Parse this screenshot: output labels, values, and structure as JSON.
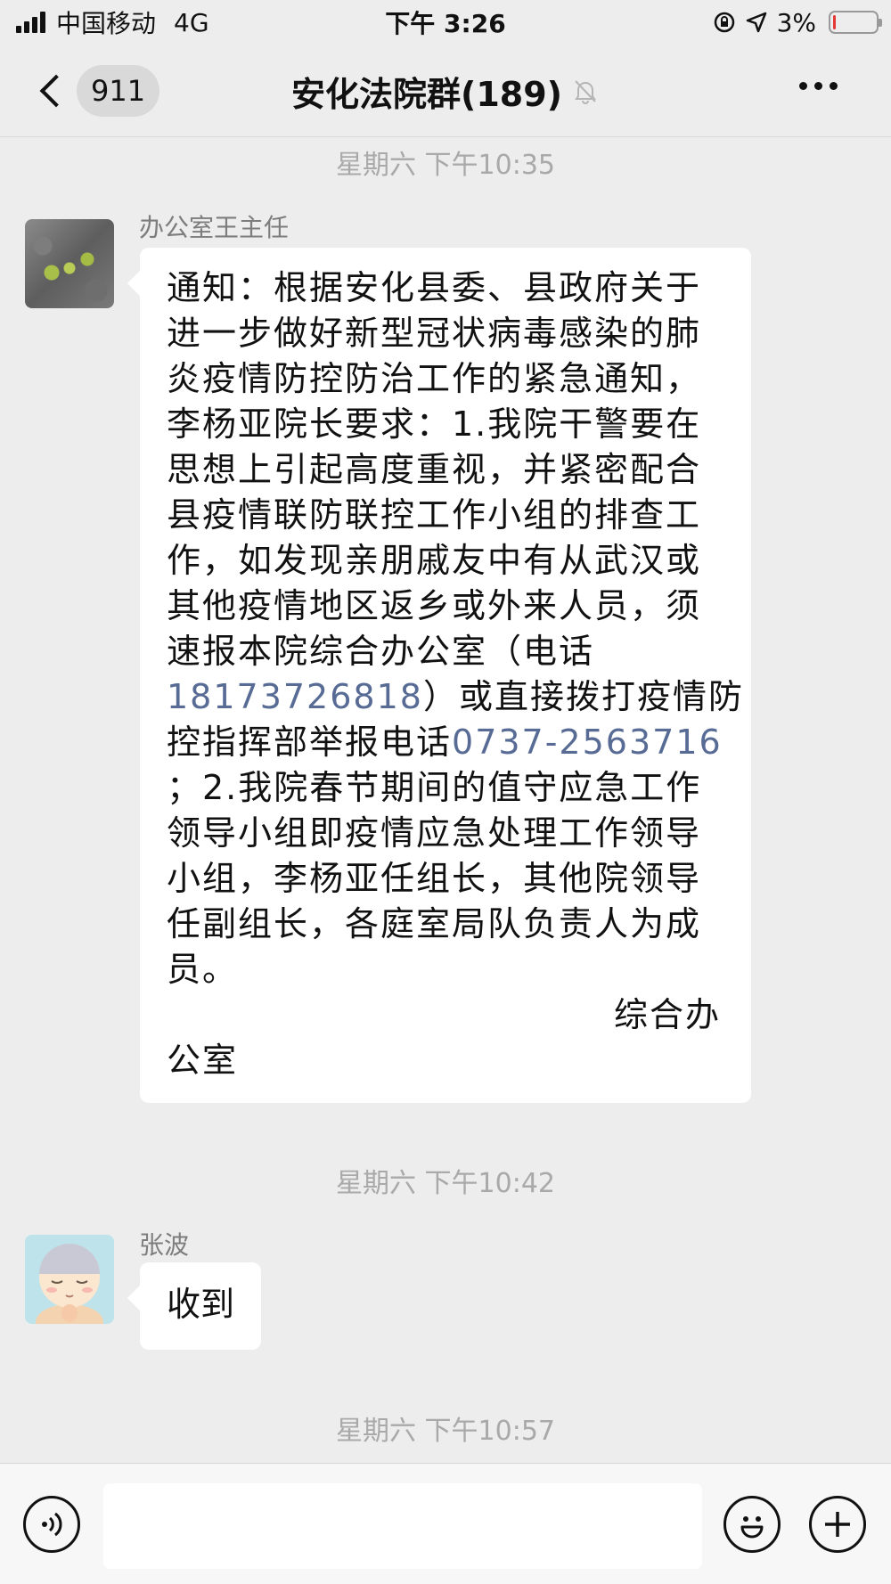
{
  "status_bar": {
    "carrier": "中国移动",
    "network": "4G",
    "time": "下午 3:26",
    "battery_text": "3%",
    "battery_level": 0.03,
    "battery_color": "#e53935"
  },
  "nav": {
    "back_icon": "chevron-left-icon",
    "unread_count": "911",
    "title": "安化法院群(189)",
    "mute_icon": "bell-off-icon",
    "more_icon": "more-dots-icon"
  },
  "chat": {
    "timestamps": [
      "星期六 下午10:35",
      "星期六 下午10:42",
      "星期六 下午10:57"
    ],
    "messages": [
      {
        "sender": "办公室王主任",
        "lines": [
          "通知：根据安化县委、县政府关于",
          "进一步做好新型冠状病毒感染的肺",
          "炎疫情防控防治工作的紧急通知，",
          "李杨亚院长要求：1.我院干警要在",
          "思想上引起高度重视，并紧密配合",
          "县疫情联防联控工作小组的排查工",
          "作，如发现亲朋戚友中有从武汉或",
          "其他疫情地区返乡或外来人员，须",
          "速报本院综合办公室（电话"
        ],
        "phone1": "18173726818",
        "after_phone1": "）或直接拨打疫情防",
        "before_phone2": "控指挥部举报电话",
        "phone2": "0737-2563716",
        "tail_lines": [
          "；2.我院春节期间的值守应急工作",
          "领导小组即疫情应急处理工作领导",
          "小组，李杨亚任组长，其他院领导",
          "任副组长，各庭室局队负责人为成",
          "员。"
        ],
        "signature_part1": "综合办",
        "signature_part2": "公室"
      },
      {
        "sender": "张波",
        "text": "收到"
      }
    ]
  },
  "input_bar": {
    "voice_icon": "voice-icon",
    "emoji_icon": "emoji-icon",
    "plus_icon": "plus-icon",
    "input_value": ""
  },
  "colors": {
    "background": "#ededed",
    "link": "#576b95",
    "bubble": "#ffffff"
  }
}
